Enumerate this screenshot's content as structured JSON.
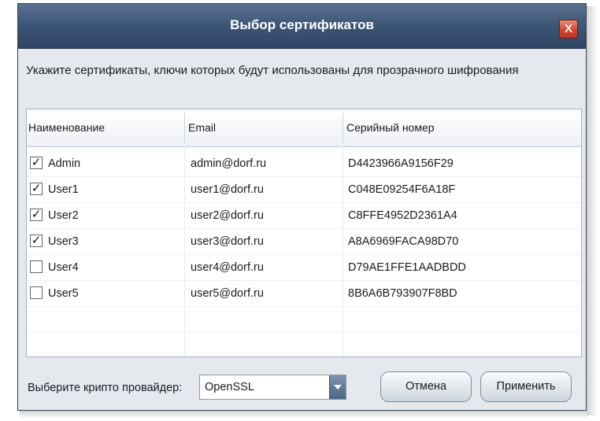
{
  "window": {
    "title": "Выбор сертификатов",
    "close_glyph": "X"
  },
  "instruction": "Укажите сертификаты, ключи которых будут использованы для прозрачного шифрования",
  "table": {
    "columns": [
      "Наименование",
      "Email",
      "Серийный номер"
    ],
    "rows": [
      {
        "checked": true,
        "check_glyph": "✓",
        "name": "Admin",
        "email": "admin@dorf.ru",
        "serial": "D4423966A9156F29"
      },
      {
        "checked": true,
        "check_glyph": "✓",
        "name": "User1",
        "email": "user1@dorf.ru",
        "serial": "C048E09254F6A18F"
      },
      {
        "checked": true,
        "check_glyph": "✓",
        "name": "User2",
        "email": "user2@dorf.ru",
        "serial": "C8FFE4952D2361A4"
      },
      {
        "checked": true,
        "check_glyph": "✓",
        "name": "User3",
        "email": "user3@dorf.ru",
        "serial": "A8A6969FACA98D70"
      },
      {
        "checked": false,
        "check_glyph": "",
        "name": "User4",
        "email": "user4@dorf.ru",
        "serial": "D79AE1FFE1AADBDD"
      },
      {
        "checked": false,
        "check_glyph": "",
        "name": "User5",
        "email": "user5@dorf.ru",
        "serial": "8B6A6B793907F8BD"
      }
    ]
  },
  "provider": {
    "label": "Выберите крипто провайдер:",
    "selected": "OpenSSL"
  },
  "buttons": {
    "cancel": "Отмена",
    "apply": "Применить"
  },
  "icons": {
    "close": "close-icon",
    "checkbox_check": "checkmark-icon",
    "dropdown": "chevron-down-icon"
  },
  "colors": {
    "titlebar": "#3f5878",
    "dialog_bg": "#e5e9ee",
    "close_button": "#d6452e"
  }
}
